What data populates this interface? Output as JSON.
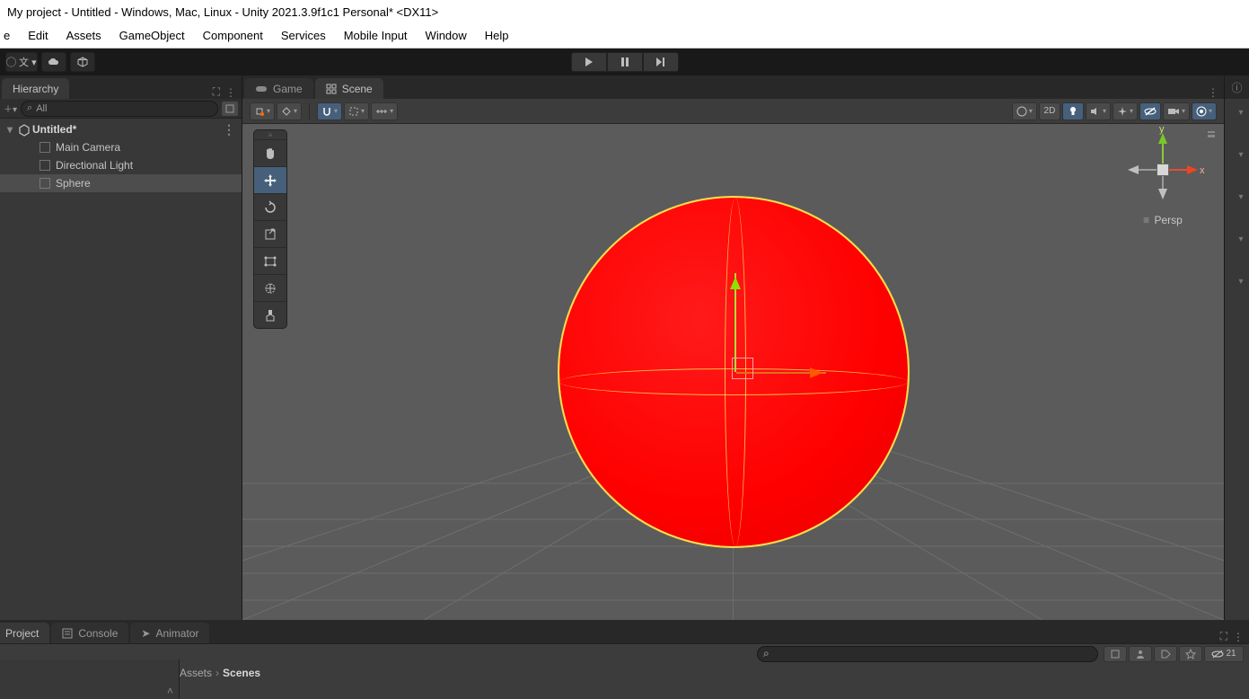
{
  "window": {
    "title": "My project - Untitled - Windows, Mac, Linux - Unity 2021.3.9f1c1 Personal* <DX11>"
  },
  "menu": {
    "items": [
      "e",
      "Edit",
      "Assets",
      "GameObject",
      "Component",
      "Services",
      "Mobile Input",
      "Window",
      "Help"
    ]
  },
  "hierarchy": {
    "tab": "Hierarchy",
    "search_placeholder": "All",
    "scene_name": "Untitled*",
    "items": [
      "Main Camera",
      "Directional Light",
      "Sphere"
    ],
    "selected_index": 2
  },
  "center_tabs": {
    "game": "Game",
    "scene": "Scene"
  },
  "scene_toolbar": {
    "mode_2d": "2D"
  },
  "gizmo": {
    "projection": "Persp",
    "x": "x",
    "y": "y"
  },
  "bottom": {
    "tabs": [
      "Project",
      "Console",
      "Animator"
    ],
    "breadcrumb": [
      "Assets",
      "Scenes"
    ],
    "hidden_count": "21"
  }
}
